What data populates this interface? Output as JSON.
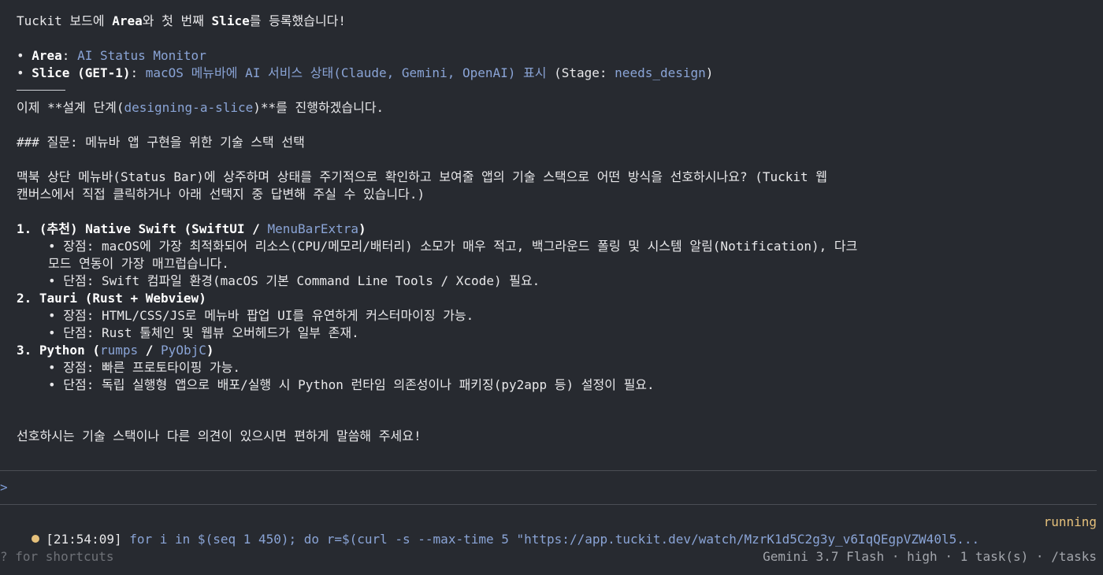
{
  "message": {
    "l1": [
      "Tuckit 보드에 ",
      "Area",
      "와 첫 번째 ",
      "Slice",
      "를 등록했습니다!"
    ],
    "area": {
      "bullet": "• ",
      "label": "Area",
      "sep": ": ",
      "value": "AI Status Monitor"
    },
    "slice": {
      "bullet": "• ",
      "label": "Slice (GET-1)",
      "sep": ": ",
      "value": "macOS 메뉴바에 AI 서비스 상태(Claude, Gemini, OpenAI) 표시",
      "stage_open": " (Stage: ",
      "stage": "needs_design",
      "stage_close": ")"
    },
    "design_pre": "이제 **설계 단계(",
    "design_link": "designing-a-slice",
    "design_post": ")**를 진행하겠습니다.",
    "question": "### 질문: 메뉴바 앱 구현을 위한 기술 스택 선택",
    "para1": "맥북 상단 메뉴바(Status Bar)에 상주하며 상태를 주기적으로 확인하고 보여줄 앱의 기술 스택으로 어떤 방식을 선호하시나요? (Tuckit 웹",
    "para2": "캔버스에서 직접 클릭하거나 아래 선택지 중 답변해 주실 수 있습니다.)",
    "opt1_title_pre": "1. (추천) Native Swift (SwiftUI / ",
    "opt1_title_link": "MenuBarExtra",
    "opt1_title_post": ")",
    "opt1_pro1": "• 장점: macOS에 가장 최적화되어 리소스(CPU/메모리/배터리) 소모가 매우 적고, 백그라운드 폴링 및 시스템 알림(Notification), 다크",
    "opt1_pro2": "모드 연동이 가장 매끄럽습니다.",
    "opt1_con": "• 단점: Swift 컴파일 환경(macOS 기본 Command Line Tools / Xcode) 필요.",
    "opt2_title": "2. Tauri (Rust + Webview)",
    "opt2_pro": "• 장점: HTML/CSS/JS로 메뉴바 팝업 UI를 유연하게 커스터마이징 가능.",
    "opt2_con": "• 단점: Rust 툴체인 및 웹뷰 오버헤드가 일부 존재.",
    "opt3_title_pre": "3. Python (",
    "opt3_link1": "rumps",
    "opt3_mid": " / ",
    "opt3_link2": "PyObjC",
    "opt3_title_post": ")",
    "opt3_pro": "• 장점: 빠른 프로토타이핑 가능.",
    "opt3_con": "• 단점: 독립 실행형 앱으로 배포/실행 시 Python 런타임 의존성이나 패키징(py2app 등) 설정이 필요.",
    "closing": "선호하시는 기술 스택이나 다른 의견이 있으시면 편하게 말씀해 주세요!"
  },
  "input": {
    "prompt": ">"
  },
  "task": {
    "time": "[21:54:09] ",
    "command": "for i in $(seq 1 450); do r=$(curl -s --max-time 5 \"https://app.tuckit.dev/watch/MzrK1d5C2g3y_v6IqQEgpVZW40l5...",
    "status": "running"
  },
  "footer": {
    "shortcuts": "? for shortcuts",
    "model": "Gemini 3.7 Flash",
    "sep": " · ",
    "effort": "high",
    "tasks": "1 task(s)",
    "tasks_cmd": "/tasks"
  },
  "colors": {
    "background": "#272a30",
    "text": "#e8e8ea",
    "link": "#8aa4d6",
    "running": "#e5c07b",
    "muted": "#6f7278"
  }
}
